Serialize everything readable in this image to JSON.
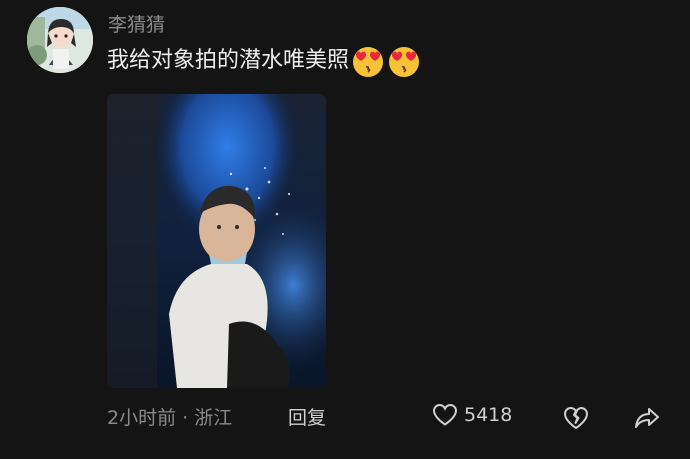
{
  "comment": {
    "username": "李猜猜",
    "text": "我给对象拍的潜水唯美照",
    "emojis": [
      "heart-eyes-emoji",
      "heart-eyes-emoji"
    ],
    "time_location": "2小时前 · 浙江",
    "reply_label": "回复",
    "like_count": "5418"
  },
  "icons": {
    "like": "heart-outline-icon",
    "dislike": "broken-heart-icon",
    "share": "share-arrow-icon"
  },
  "colors": {
    "background": "#141414",
    "text_primary": "#ededed",
    "text_secondary": "#8a8a8a",
    "emoji_face": "#f7c236",
    "emoji_heart": "#e8283c"
  }
}
